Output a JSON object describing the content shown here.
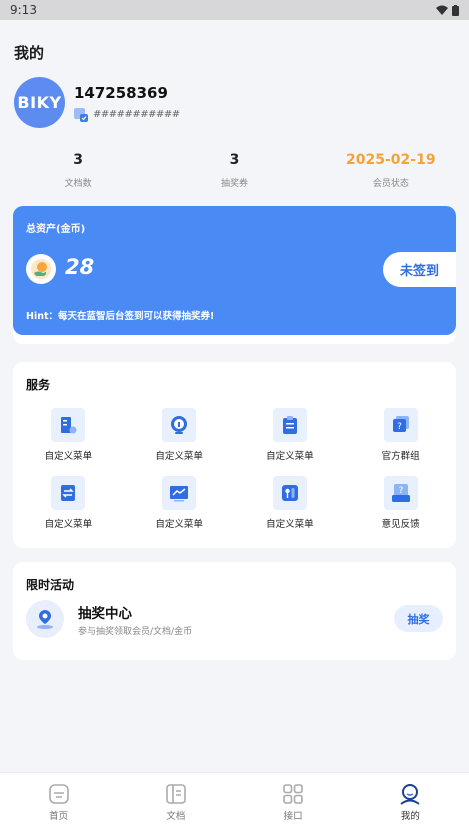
{
  "status_bar": {
    "time": "9:13"
  },
  "page": {
    "title": "我的"
  },
  "profile": {
    "avatar_text": "BIKY",
    "username": "147258369",
    "user_id": "###########"
  },
  "stats": [
    {
      "value": "3",
      "label": "文档数"
    },
    {
      "value": "3",
      "label": "抽奖券"
    },
    {
      "value": "2025-02-19",
      "label": "会员状态"
    }
  ],
  "assets": {
    "title": "总资产(金币)",
    "value": "28",
    "checkin_label": "未签到",
    "hint": "Hint：每天在蓝智后台签到可以获得抽奖券!"
  },
  "services": {
    "title": "服务",
    "items": [
      {
        "label": "自定义菜单",
        "icon": "building-doc-icon"
      },
      {
        "label": "自定义菜单",
        "icon": "info-circle-icon"
      },
      {
        "label": "自定义菜单",
        "icon": "clipboard-list-icon"
      },
      {
        "label": "官方群组",
        "icon": "chat-question-icon"
      },
      {
        "label": "自定义菜单",
        "icon": "swap-doc-icon"
      },
      {
        "label": "自定义菜单",
        "icon": "chart-line-icon"
      },
      {
        "label": "自定义菜单",
        "icon": "tools-icon"
      },
      {
        "label": "意见反馈",
        "icon": "feedback-box-icon"
      }
    ]
  },
  "activity": {
    "title": "限时活动",
    "item_title": "抽奖中心",
    "item_subtitle": "参与抽奖领取会员/文档/金币",
    "button_label": "抽奖"
  },
  "tabbar": {
    "items": [
      {
        "label": "首页",
        "icon": "home-icon"
      },
      {
        "label": "文档",
        "icon": "document-icon"
      },
      {
        "label": "接口",
        "icon": "api-grid-icon"
      },
      {
        "label": "我的",
        "icon": "profile-icon"
      }
    ],
    "active": "我的"
  },
  "colors": {
    "accent_blue": "#4a8af4",
    "accent_orange": "#f2a33a",
    "background": "#f4f5f9"
  }
}
